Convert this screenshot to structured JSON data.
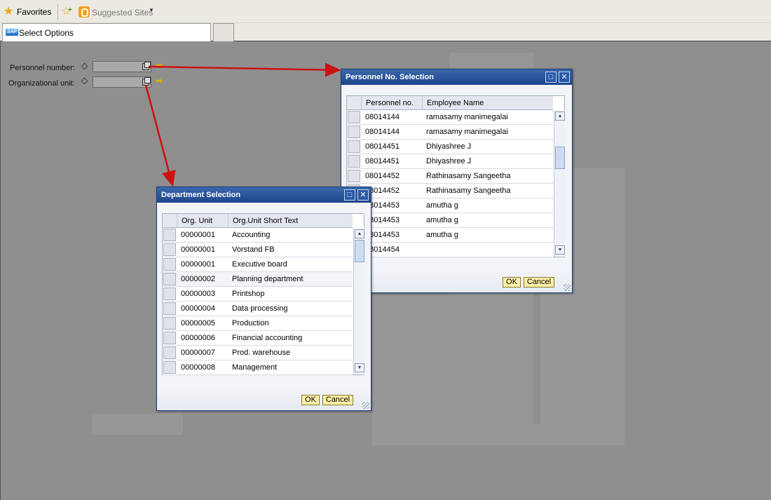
{
  "favbar": {
    "favorites_label": "Favorites",
    "suggested_label": "Suggested Sites"
  },
  "tabs": {
    "active_label": "Select Options",
    "logo_text": "SAP"
  },
  "form": {
    "personnel_label": "Personnel number:",
    "orgunit_label": "Organizational unit:"
  },
  "personnel_dialog": {
    "title": "Personnel No. Selection",
    "columns": [
      "Personnel no.",
      "Employee Name"
    ],
    "rows": [
      [
        "08014144",
        "ramasamy manimegalai"
      ],
      [
        "08014144",
        "ramasamy manimegalai"
      ],
      [
        "08014451",
        "Dhiyashree J"
      ],
      [
        "08014451",
        "Dhiyashree J"
      ],
      [
        "08014452",
        "Rathinasamy Sangeetha"
      ],
      [
        "08014452",
        "Rathinasamy Sangeetha"
      ],
      [
        "08014453",
        "amutha g"
      ],
      [
        "08014453",
        "amutha g"
      ],
      [
        "08014453",
        "amutha g"
      ],
      [
        "08014454",
        ""
      ]
    ],
    "ok_label": "OK",
    "cancel_label": "Cancel"
  },
  "department_dialog": {
    "title": "Department Selection",
    "columns": [
      "Org. Unit",
      "Org.Unit Short Text"
    ],
    "rows": [
      [
        "00000001",
        "Accounting"
      ],
      [
        "00000001",
        "Vorstand FB"
      ],
      [
        "00000001",
        "Executive board"
      ],
      [
        "00000002",
        "Planning department"
      ],
      [
        "00000003",
        "Printshop"
      ],
      [
        "00000004",
        "Data processing"
      ],
      [
        "00000005",
        "Production"
      ],
      [
        "00000006",
        "Financial accounting"
      ],
      [
        "00000007",
        "Prod. warehouse"
      ],
      [
        "00000008",
        "Management"
      ]
    ],
    "ok_label": "OK",
    "cancel_label": "Cancel"
  },
  "colors": {
    "arrow": "#cc1111",
    "title_bar": "#1d4489",
    "ok_button": "#fff0a8"
  }
}
